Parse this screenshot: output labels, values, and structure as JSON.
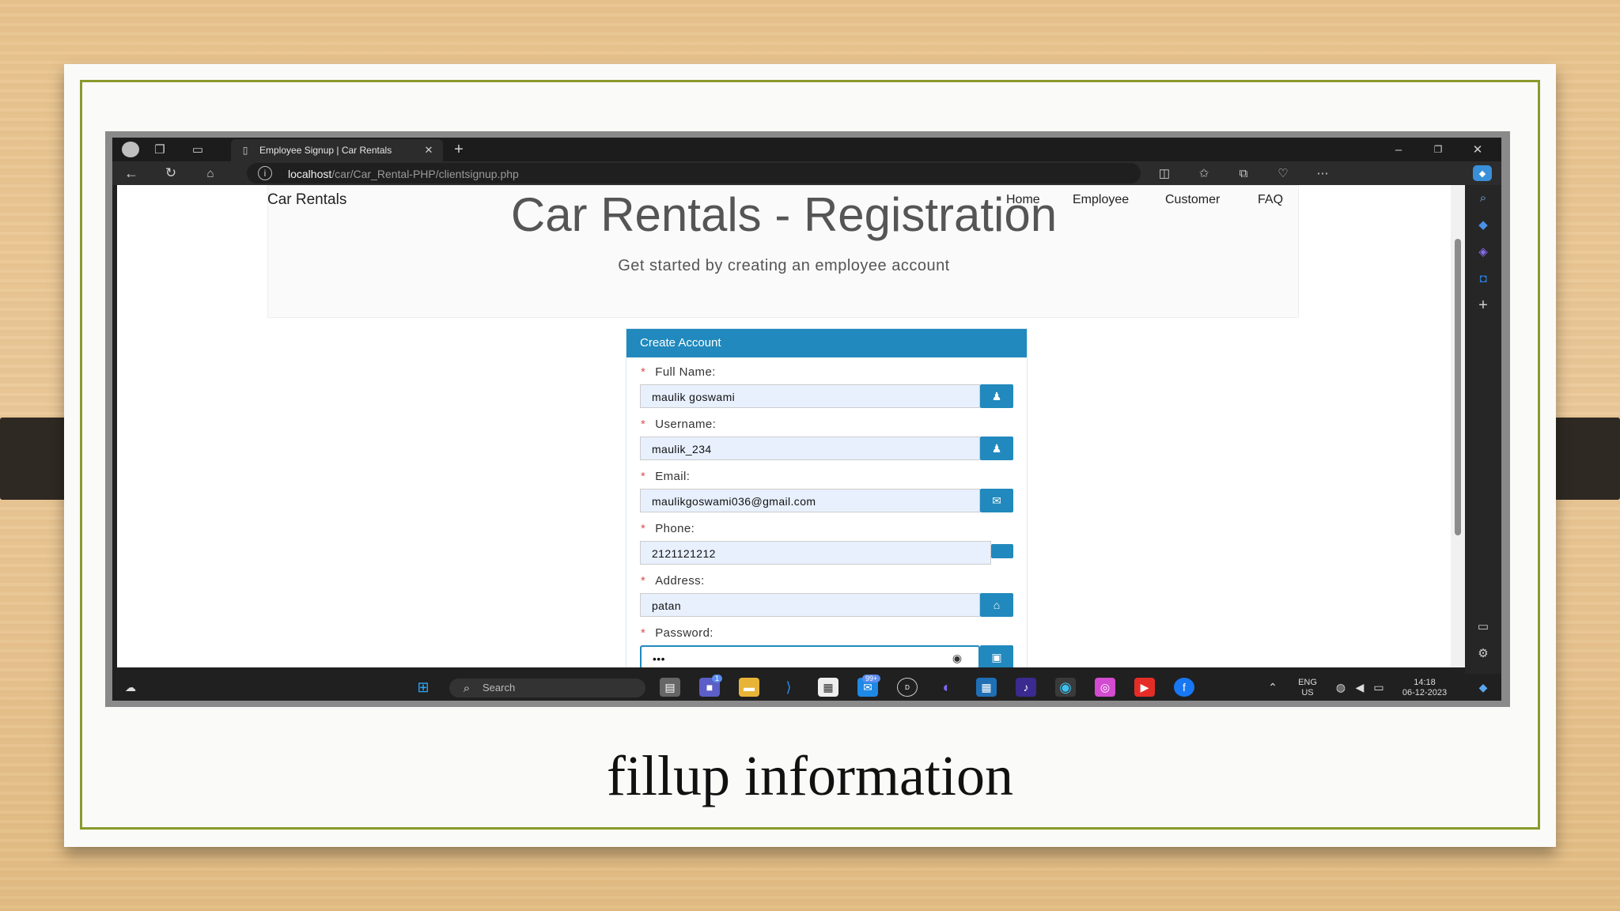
{
  "slide": {
    "caption": "fillup information",
    "border_color": "#8a9a2c"
  },
  "browser": {
    "tab_title": "Employee Signup | Car Rentals",
    "url_host": "localhost",
    "url_path": "/car/Car_Rental-PHP/clientsignup.php"
  },
  "site": {
    "brand": "Car Rentals",
    "nav": [
      "Home",
      "Employee",
      "Customer",
      "FAQ"
    ],
    "title": "Car Rentals - Registration",
    "subtitle": "Get started by creating an employee account"
  },
  "form": {
    "heading": "Create Account",
    "required_mark": "*",
    "fields": [
      {
        "label": "Full Name:",
        "value": "maulik goswami",
        "icon": "user-icon"
      },
      {
        "label": "Username:",
        "value": "maulik_234",
        "icon": "user-icon"
      },
      {
        "label": "Email:",
        "value": "maulikgoswami036@gmail.com",
        "icon": "envelope-icon"
      },
      {
        "label": "Phone:",
        "value": "2121121212",
        "icon": "phone-icon"
      },
      {
        "label": "Address:",
        "value": "patan",
        "icon": "home-icon"
      },
      {
        "label": "Password:",
        "value": "•••",
        "icon": "lock-icon"
      }
    ],
    "accent": "#2189bd"
  },
  "taskbar": {
    "search_placeholder": "Search",
    "lang_top": "ENG",
    "lang_bottom": "US",
    "time": "14:18",
    "date": "06-12-2023",
    "badge_teams": "1",
    "badge_mail": "99+"
  }
}
